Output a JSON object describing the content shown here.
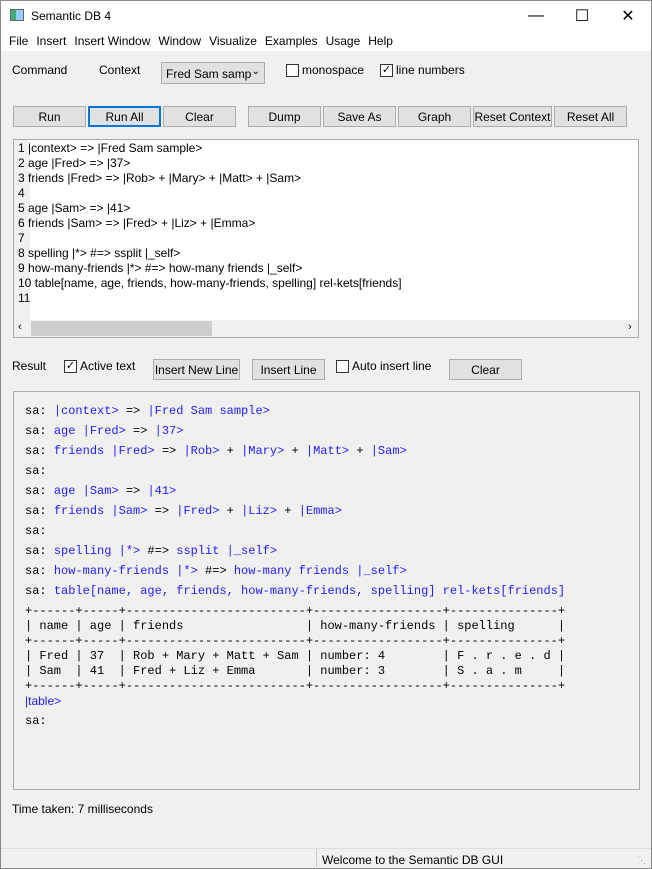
{
  "window": {
    "title": "Semantic DB 4"
  },
  "menu": [
    "File",
    "Insert",
    "Insert Window",
    "Window",
    "Visualize",
    "Examples",
    "Usage",
    "Help"
  ],
  "command": {
    "label": "Command",
    "context_label": "Context",
    "context_value": "Fred Sam samp",
    "monospace_label": "monospace",
    "monospace_checked": false,
    "line_numbers_label": "line numbers",
    "line_numbers_checked": true
  },
  "buttons": {
    "run": "Run",
    "run_all": "Run All",
    "clear": "Clear",
    "dump": "Dump",
    "save_as": "Save As",
    "graph": "Graph",
    "reset_context": "Reset Context",
    "reset_all": "Reset All"
  },
  "editor_lines": [
    "|context> => |Fred Sam sample>",
    "age |Fred> => |37>",
    "friends |Fred> => |Rob> + |Mary> + |Matt> + |Sam>",
    "",
    "age |Sam> => |41>",
    "friends |Sam> => |Fred> + |Liz> + |Emma>",
    "",
    "spelling |*> #=> ssplit |_self>",
    "how-many-friends |*> #=> how-many friends |_self>",
    "table[name, age, friends, how-many-friends, spelling] rel-kets[friends]",
    ""
  ],
  "result_bar": {
    "label": "Result",
    "active_text_label": "Active text",
    "active_text_checked": true,
    "insert_new_line": "Insert New Line",
    "insert_line": "Insert Line",
    "auto_insert_label": "Auto insert line",
    "auto_insert_checked": false,
    "clear": "Clear"
  },
  "result_lines": [
    [
      [
        "sa: ",
        "k"
      ],
      [
        "|context>",
        "b"
      ],
      [
        " => ",
        "k"
      ],
      [
        "|Fred Sam sample>",
        "b"
      ]
    ],
    [
      [
        "sa: ",
        "k"
      ],
      [
        "age |Fred>",
        "b"
      ],
      [
        " => ",
        "k"
      ],
      [
        "|37>",
        "b"
      ]
    ],
    [
      [
        "sa: ",
        "k"
      ],
      [
        "friends |Fred>",
        "b"
      ],
      [
        " => ",
        "k"
      ],
      [
        "|Rob>",
        "b"
      ],
      [
        " + ",
        "k"
      ],
      [
        "|Mary>",
        "b"
      ],
      [
        " + ",
        "k"
      ],
      [
        "|Matt>",
        "b"
      ],
      [
        " + ",
        "k"
      ],
      [
        "|Sam>",
        "b"
      ]
    ],
    [
      [
        "sa:",
        "k"
      ]
    ],
    [
      [
        "sa: ",
        "k"
      ],
      [
        "age |Sam>",
        "b"
      ],
      [
        " => ",
        "k"
      ],
      [
        "|41>",
        "b"
      ]
    ],
    [
      [
        "sa: ",
        "k"
      ],
      [
        "friends |Sam>",
        "b"
      ],
      [
        " => ",
        "k"
      ],
      [
        "|Fred>",
        "b"
      ],
      [
        " + ",
        "k"
      ],
      [
        "|Liz>",
        "b"
      ],
      [
        " + ",
        "k"
      ],
      [
        "|Emma>",
        "b"
      ]
    ],
    [
      [
        "sa:",
        "k"
      ]
    ],
    [
      [
        "sa: ",
        "k"
      ],
      [
        "spelling |*>",
        "b"
      ],
      [
        " #=> ",
        "k"
      ],
      [
        "ssplit |_self>",
        "b"
      ]
    ],
    [
      [
        "sa: ",
        "k"
      ],
      [
        "how-many-friends |*>",
        "b"
      ],
      [
        " #=> ",
        "k"
      ],
      [
        "how-many friends |_self>",
        "b"
      ]
    ],
    [
      [
        "sa: ",
        "k"
      ],
      [
        "table[name, age, friends, how-many-friends, spelling] rel-kets[friends]",
        "b"
      ]
    ]
  ],
  "table_lines": [
    "+------+-----+-------------------------+------------------+---------------+",
    "| name | age | friends                 | how-many-friends | spelling      |",
    "+------+-----+-------------------------+------------------+---------------+",
    "| Fred | 37  | Rob + Mary + Matt + Sam | number: 4        | F . r . e . d |",
    "| Sam  | 41  | Fred + Liz + Emma       | number: 3        | S . a . m     |",
    "+------+-----+-------------------------+------------------+---------------+"
  ],
  "table_ket": "|table>",
  "final_prompt": "sa:",
  "time_taken": "Time taken: 7 milliseconds",
  "status": "Welcome to the Semantic DB GUI"
}
